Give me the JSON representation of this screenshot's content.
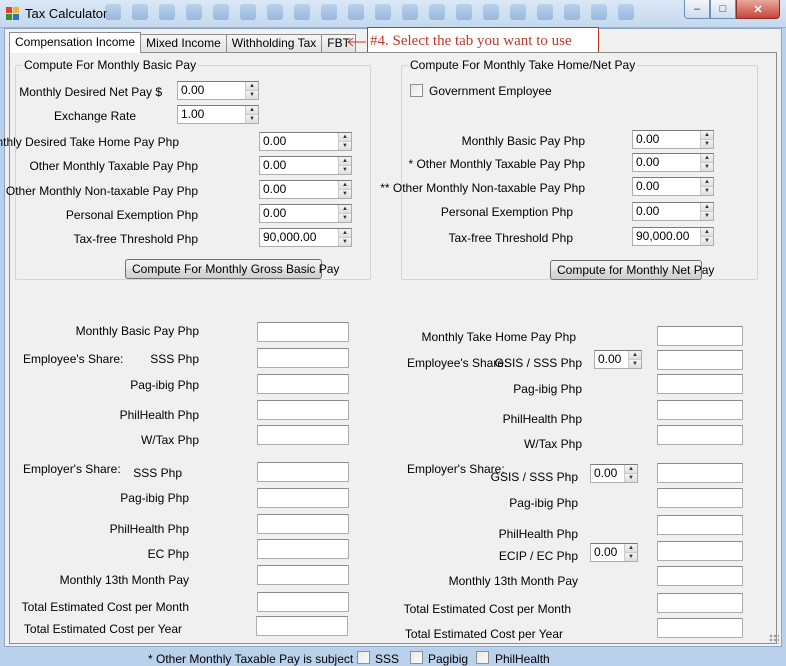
{
  "window": {
    "title": "Tax Calculator",
    "minimize_glyph": "–",
    "maximize_glyph": "□",
    "close_glyph": "✕"
  },
  "tabs": [
    "Compensation Income",
    "Mixed Income",
    "Withholding Tax",
    "FBT"
  ],
  "active_tab": "Compensation Income",
  "callout": {
    "text": "#4. Select the tab you want to use",
    "color": "#c0392b"
  },
  "left_group": {
    "title": "Compute For Monthly Basic Pay",
    "fields": {
      "net_pay": {
        "label": "Monthly Desired Net Pay $",
        "value": "0.00"
      },
      "exchange_rate": {
        "label": "Exchange Rate",
        "value": "1.00"
      },
      "take_home": {
        "label": "Monthly Desired Take Home Pay  Php",
        "value": "0.00"
      },
      "other_taxable": {
        "label": "Other Monthly Taxable Pay Php",
        "value": "0.00"
      },
      "other_nontaxable": {
        "label": "Other Monthly Non-taxable Pay Php",
        "value": "0.00"
      },
      "personal_exemption": {
        "label": "Personal Exemption Php",
        "value": "0.00"
      },
      "taxfree_threshold": {
        "label": "Tax-free Threshold Php",
        "value": "90,000.00"
      }
    },
    "button": "Compute For Monthly Gross Basic Pay"
  },
  "right_group": {
    "title": "Compute For Monthly Take Home/Net Pay",
    "government_employee": {
      "label": "Government Employee",
      "checked": false
    },
    "fields": {
      "basic_pay": {
        "label": "Monthly Basic Pay Php",
        "value": "0.00"
      },
      "other_taxable": {
        "label": "* Other Monthly Taxable Pay Php",
        "value": "0.00"
      },
      "other_nontaxable": {
        "label": "** Other Monthly Non-taxable Pay Php",
        "value": "0.00"
      },
      "personal_exemption": {
        "label": "Personal Exemption Php",
        "value": "0.00"
      },
      "taxfree_threshold": {
        "label": "Tax-free Threshold Php",
        "value": "90,000.00"
      }
    },
    "button": "Compute for Monthly Net Pay"
  },
  "left_results": {
    "basic_pay": "Monthly  Basic Pay Php",
    "employee_share": "Employee's Share:",
    "sss": "SSS Php",
    "pagibig": "Pag-ibig Php",
    "philhealth": "PhilHealth Php",
    "wtax": "W/Tax Php",
    "employer_share": "Employer's Share:",
    "er_sss": "SSS Php",
    "er_pagibig": "Pag-ibig Php",
    "er_philhealth": "PhilHealth Php",
    "ec": "EC Php",
    "thirteenth": "Monthly 13th Month Pay",
    "cost_month": "Total Estimated Cost per Month",
    "cost_year": "Total Estimated Cost per Year"
  },
  "right_results": {
    "take_home": "Monthly Take Home Pay Php",
    "employee_share": "Employee's Share:",
    "gsis_sss": "GSIS / SSS Php",
    "gsis_sss_rate": "0.00",
    "pagibig": "Pag-ibig Php",
    "philhealth": "PhilHealth Php",
    "wtax": "W/Tax Php",
    "employer_share": "Employer's Share:",
    "er_gsis_sss": "GSIS / SSS Php",
    "er_gsis_sss_rate": "0.00",
    "er_pagibig": "Pag-ibig Php",
    "er_philhealth": "PhilHealth Php",
    "ecip_ec": "ECIP / EC Php",
    "ecip_ec_rate": "0.00",
    "thirteenth": "Monthly 13th Month Pay",
    "cost_month": "Total Estimated Cost per Month",
    "cost_year": "Total Estimated Cost per Year"
  },
  "footer": {
    "note": "* Other Monthly Taxable Pay is subject to:",
    "options": [
      {
        "label": "SSS",
        "checked": false
      },
      {
        "label": "Pagibig",
        "checked": false
      },
      {
        "label": "PhilHealth",
        "checked": false
      }
    ]
  }
}
